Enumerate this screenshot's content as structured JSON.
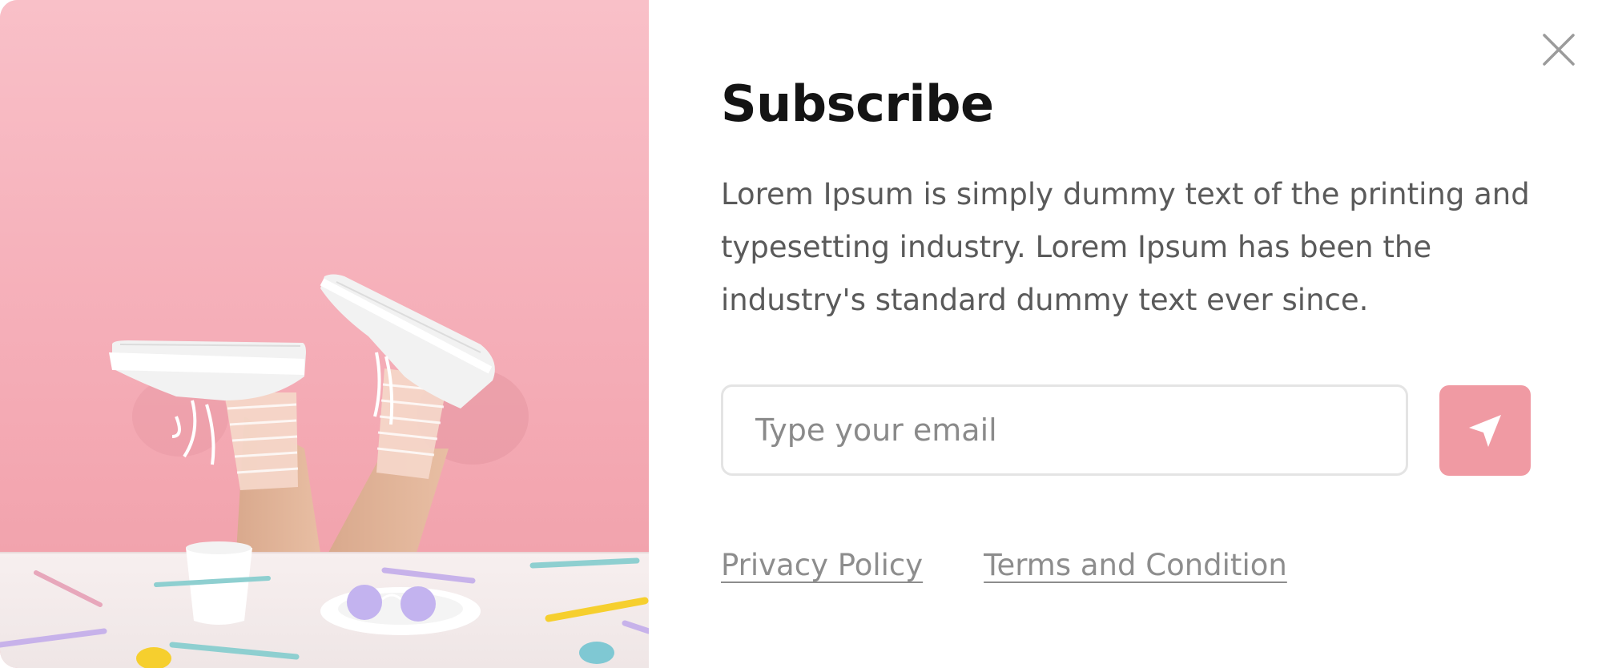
{
  "modal": {
    "title": "Subscribe",
    "description": "Lorem Ipsum is simply dummy text of the printing and typesetting industry. Lorem Ipsum has been the industry's standard dummy text ever since.",
    "close_icon": "close-icon"
  },
  "form": {
    "email_placeholder": "Type your email",
    "email_value": "",
    "submit_icon": "send-arrow-icon"
  },
  "footer": {
    "privacy_label": "Privacy Policy",
    "terms_label": "Terms and Condition"
  },
  "colors": {
    "accent": "#f09aa3",
    "background_pink": "#f6b0ba",
    "title": "#141414",
    "body_text": "#5a5a5a",
    "link": "#8d8d8d"
  }
}
